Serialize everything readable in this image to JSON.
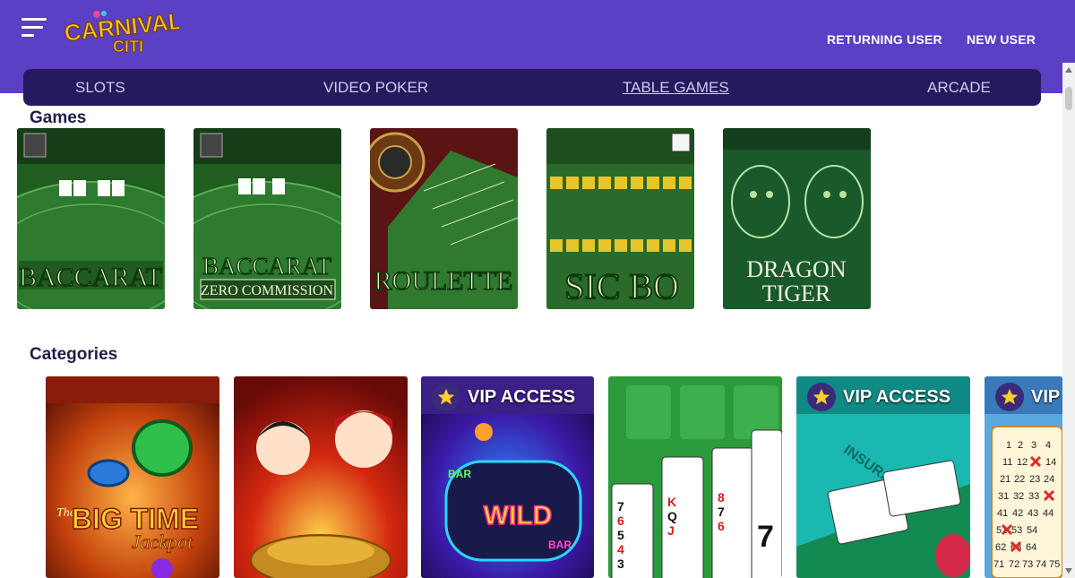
{
  "header": {
    "logo_line1": "CARNIVAL",
    "logo_line2": "CITI",
    "returning_user": "RETURNING USER",
    "new_user": "NEW USER"
  },
  "nav": {
    "items": [
      "SLOTS",
      "VIDEO POKER",
      "TABLE GAMES",
      "ARCADE"
    ],
    "active": "TABLE GAMES"
  },
  "games": {
    "title": "Games",
    "tiles": [
      {
        "name": "BACCARAT",
        "subtitle": ""
      },
      {
        "name": "BACCARAT",
        "subtitle": "ZERO COMMISSION"
      },
      {
        "name": "ROULETTE",
        "subtitle": ""
      },
      {
        "name": "SIC BO",
        "subtitle": ""
      },
      {
        "name": "DRAGON",
        "subtitle": "TIGER"
      }
    ]
  },
  "categories": {
    "title": "Categories",
    "tiles": [
      {
        "text1": "The",
        "text2": "BIG TIME",
        "text3": "Jackpot"
      },
      {
        "text1": "",
        "text2": "",
        "text3": ""
      },
      {
        "badge": "VIP ACCESS",
        "text1": "BAR",
        "text2": "WILD",
        "text3": "BAR"
      },
      {
        "cards": [
          "7",
          "6",
          "5",
          "4",
          "3",
          "K",
          "Q",
          "J",
          "8",
          "7",
          "6",
          "7"
        ]
      },
      {
        "badge": "VIP ACCESS",
        "text1": "INSURANCE"
      },
      {
        "badge": "VIP",
        "numbers": [
          "1",
          "2",
          "3",
          "4",
          "11",
          "12",
          "14",
          "21",
          "22",
          "23",
          "24",
          "31",
          "32",
          "33",
          "41",
          "42",
          "43",
          "44",
          "51",
          "53",
          "54",
          "62",
          "63",
          "64",
          "71",
          "72",
          "73",
          "74",
          "75"
        ]
      }
    ]
  }
}
